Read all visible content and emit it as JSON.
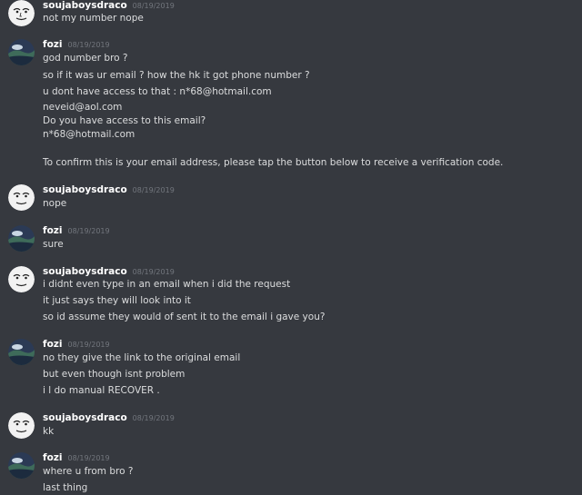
{
  "colors": {
    "background": "#36393f",
    "text": "#dcddde",
    "username": "#ffffff",
    "timestamp": "#72767d"
  },
  "avatars": {
    "soujaboysdraco": "meme-face-avatar",
    "fozi": "landscape-avatar"
  },
  "messages": [
    {
      "user": "soujaboysdraco",
      "time": "08/19/2019",
      "lines": [
        "not my number nope"
      ]
    },
    {
      "user": "fozi",
      "time": "08/19/2019",
      "lines": [
        "god number bro ?",
        "so if it was ur email ? how the hk it got phone number ?",
        "u dont have access to that : n*68@hotmail.com",
        "neveid@aol.com",
        "Do you have access to this email?",
        "n*68@hotmail.com",
        "To confirm this is your email address, please tap the button below to receive a verification code."
      ]
    },
    {
      "user": "soujaboysdraco",
      "time": "08/19/2019",
      "lines": [
        "nope"
      ]
    },
    {
      "user": "fozi",
      "time": "08/19/2019",
      "lines": [
        "sure"
      ]
    },
    {
      "user": "soujaboysdraco",
      "time": "08/19/2019",
      "lines": [
        "i didnt even type in an email when i did the request",
        "it just says they will look into it",
        "so id assume they would of sent it to the email i gave you?"
      ]
    },
    {
      "user": "fozi",
      "time": "08/19/2019",
      "lines": [
        "no they give the link to the original email",
        "but even though isnt problem",
        "i l do manual RECOVER ."
      ]
    },
    {
      "user": "soujaboysdraco",
      "time": "08/19/2019",
      "lines": [
        "kk"
      ]
    },
    {
      "user": "fozi",
      "time": "08/19/2019",
      "lines": [
        "where u from bro ?",
        "last thing"
      ]
    }
  ]
}
